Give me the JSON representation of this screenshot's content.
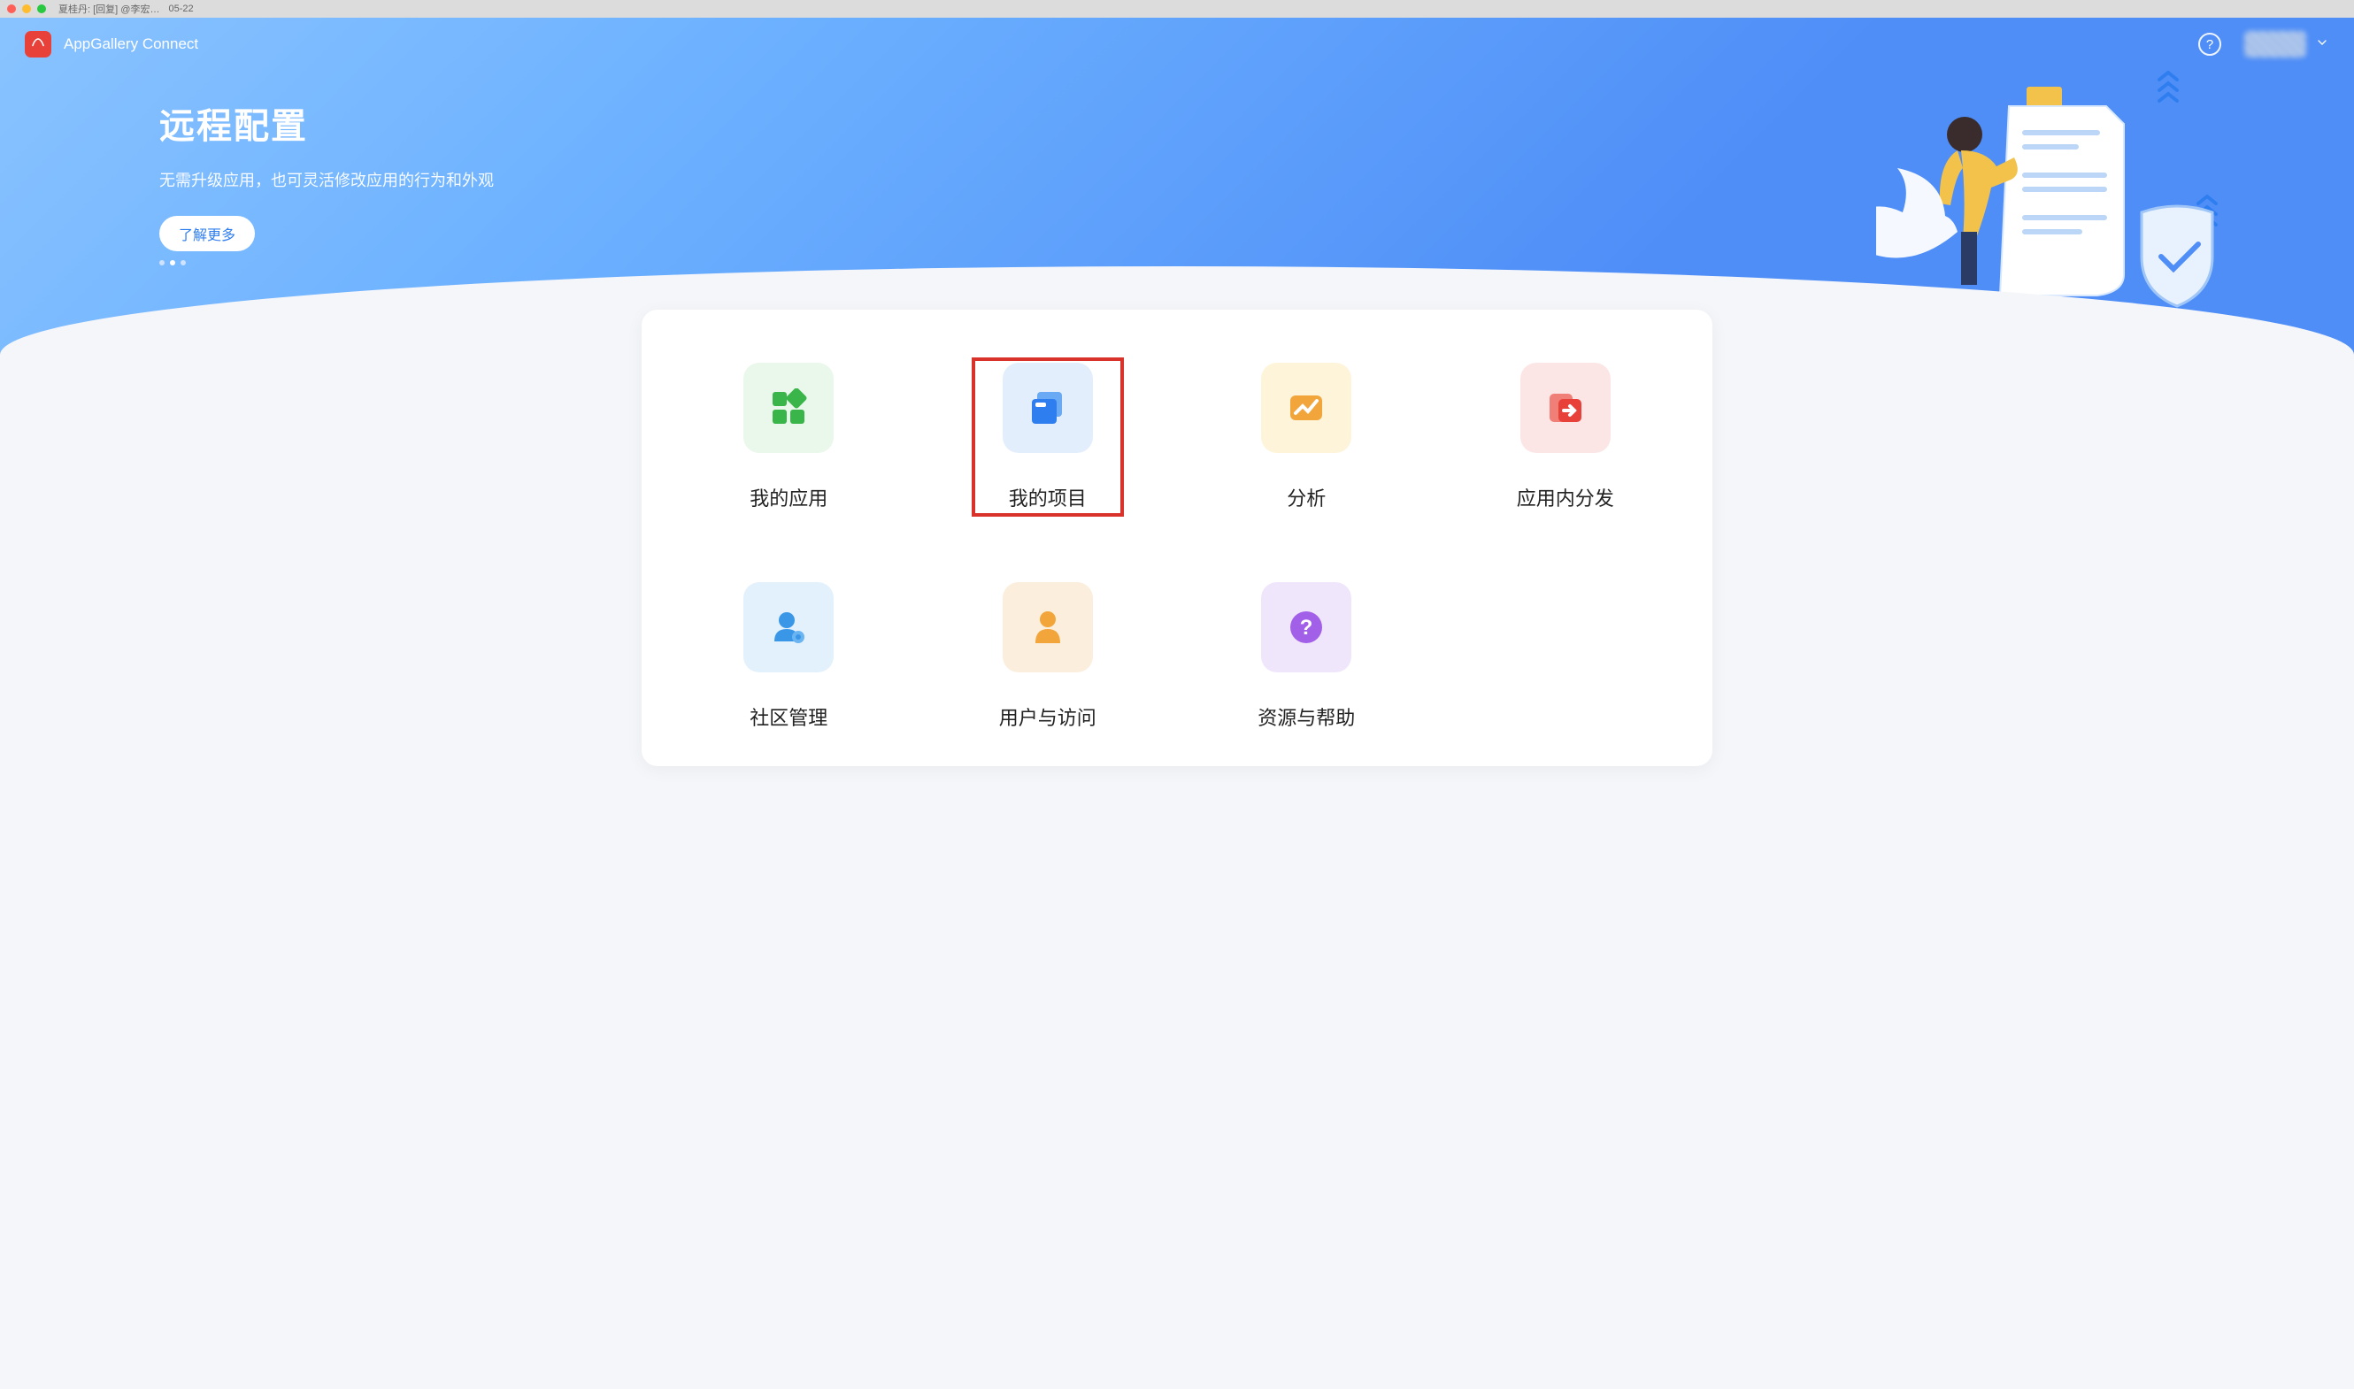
{
  "os": {
    "tab_text": "夏桂丹: [回复] @李宏…",
    "tab_date": "05-22"
  },
  "header": {
    "brand": "AppGallery Connect"
  },
  "hero": {
    "title": "远程配置",
    "subtitle": "无需升级应用，也可灵活修改应用的行为和外观",
    "cta": "了解更多"
  },
  "tiles": [
    {
      "id": "my-apps",
      "label": "我的应用",
      "icon": "apps",
      "color": "c-green"
    },
    {
      "id": "my-projects",
      "label": "我的项目",
      "icon": "projects",
      "color": "c-blue",
      "highlighted": true
    },
    {
      "id": "analytics",
      "label": "分析",
      "icon": "analytics",
      "color": "c-yellow"
    },
    {
      "id": "in-app-dist",
      "label": "应用内分发",
      "icon": "dist",
      "color": "c-red"
    },
    {
      "id": "community",
      "label": "社区管理",
      "icon": "community",
      "color": "c-lblue"
    },
    {
      "id": "users-access",
      "label": "用户与访问",
      "icon": "user",
      "color": "c-orange"
    },
    {
      "id": "resources-help",
      "label": "资源与帮助",
      "icon": "help",
      "color": "c-purple"
    }
  ]
}
